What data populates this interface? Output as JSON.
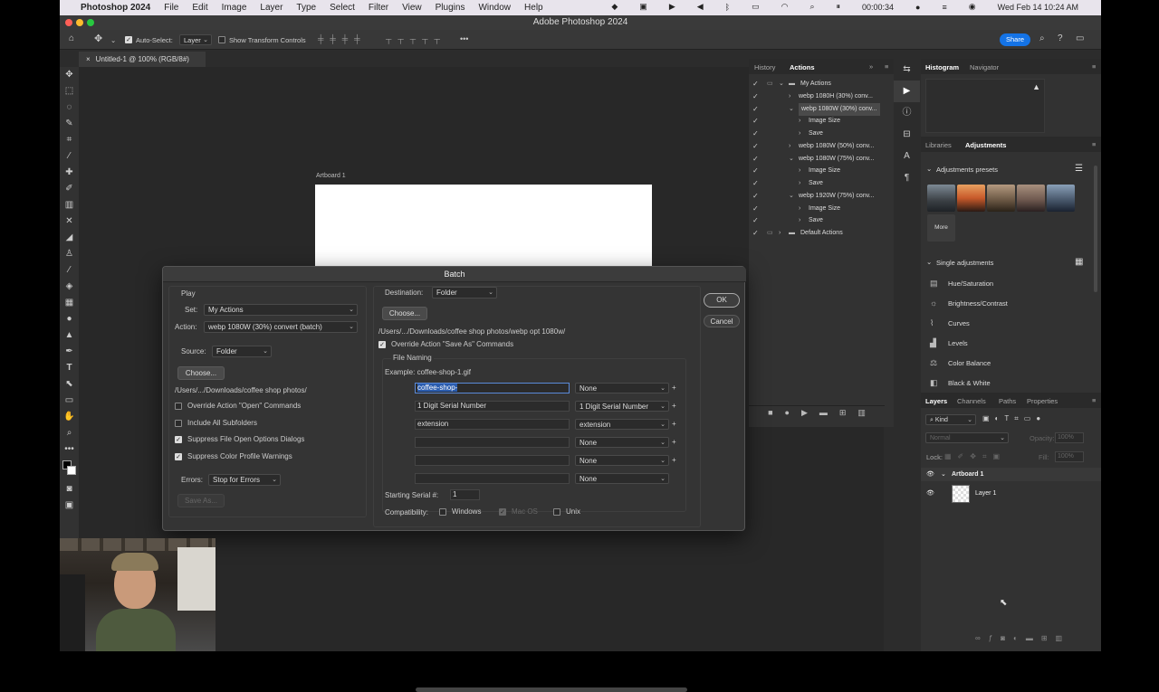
{
  "menubar": {
    "apple": "",
    "app": "Photoshop 2024",
    "items": [
      "File",
      "Edit",
      "Image",
      "Layer",
      "Type",
      "Select",
      "Filter",
      "View",
      "Plugins",
      "Window",
      "Help"
    ],
    "recording_time": "00:00:34",
    "datetime": "Wed Feb 14  10:24 AM"
  },
  "window": {
    "title": "Adobe Photoshop 2024",
    "share": "Share"
  },
  "options": {
    "auto_select": "Auto-Select:",
    "auto_select_value": "Layer",
    "transform_controls": "Show Transform Controls",
    "more": "•••"
  },
  "document": {
    "tab": "Untitled-1 @ 100% (RGB/8#)",
    "artboard_label": "Artboard 1"
  },
  "actions_panel": {
    "tabs": [
      "History",
      "Actions"
    ],
    "rows": [
      {
        "label": "My Actions",
        "indent": 0,
        "folder": true,
        "open": true
      },
      {
        "label": "webp 1080H (30%) conv...",
        "indent": 1
      },
      {
        "label": "webp 1080W (30%) conv...",
        "indent": 1,
        "open": true,
        "selected": true
      },
      {
        "label": "Image Size",
        "indent": 2
      },
      {
        "label": "Save",
        "indent": 2
      },
      {
        "label": "webp 1080W (50%) conv...",
        "indent": 1
      },
      {
        "label": "webp 1080W (75%) conv...",
        "indent": 1,
        "open": true
      },
      {
        "label": "Image Size",
        "indent": 2
      },
      {
        "label": "Save",
        "indent": 2
      },
      {
        "label": "webp 1920W (75%) conv...",
        "indent": 1,
        "open": true
      },
      {
        "label": "Image Size",
        "indent": 2
      },
      {
        "label": "Save",
        "indent": 2
      },
      {
        "label": "Default Actions",
        "indent": 0,
        "folder": true
      }
    ]
  },
  "right_panels": {
    "histogram_tabs": [
      "Histogram",
      "Navigator"
    ],
    "adjust_tabs": [
      "Libraries",
      "Adjustments"
    ],
    "presets_title": "Adjustments presets",
    "more": "More",
    "single_title": "Single adjustments",
    "adjustments": [
      "Hue/Saturation",
      "Brightness/Contrast",
      "Curves",
      "Levels",
      "Color Balance",
      "Black & White"
    ],
    "layers_tabs": [
      "Layers",
      "Channels",
      "Paths",
      "Properties"
    ],
    "kind": "Kind",
    "blend": "Normal",
    "opacity": "Opacity:",
    "opacity_val": "100%",
    "lock": "Lock:",
    "fill": "Fill:",
    "fill_val": "100%",
    "layers": [
      "Artboard 1",
      "Layer 1"
    ]
  },
  "batch": {
    "title": "Batch",
    "play": "Play",
    "set_label": "Set:",
    "set_value": "My Actions",
    "action_label": "Action:",
    "action_value": "webp 1080W (30%) convert (batch)",
    "source_label": "Source:",
    "source_value": "Folder",
    "choose": "Choose...",
    "source_path": "/Users/.../Downloads/coffee shop photos/",
    "override_open": "Override Action \"Open\" Commands",
    "include_sub": "Include All Subfolders",
    "suppress_file": "Suppress File Open Options Dialogs",
    "suppress_color": "Suppress Color Profile Warnings",
    "errors_label": "Errors:",
    "errors_value": "Stop for Errors",
    "save_as": "Save As...",
    "dest_label": "Destination:",
    "dest_value": "Folder",
    "dest_choose": "Choose...",
    "dest_path": "/Users/.../Downloads/coffee shop photos/webp opt 1080w/",
    "override_save": "Override Action \"Save As\" Commands",
    "file_naming": "File Naming",
    "example": "Example: coffee-shop-1.gif",
    "naming": [
      {
        "field": "coffee-shop-",
        "select": "None"
      },
      {
        "field": "1 Digit Serial Number",
        "select": "1 Digit Serial Number"
      },
      {
        "field": "extension",
        "select": "extension"
      },
      {
        "field": "",
        "select": "None"
      },
      {
        "field": "",
        "select": "None"
      },
      {
        "field": "",
        "select": "None"
      }
    ],
    "serial_label": "Starting Serial #:",
    "serial_value": "1",
    "compat_label": "Compatibility:",
    "windows": "Windows",
    "macos": "Mac OS",
    "unix": "Unix",
    "ok": "OK",
    "cancel": "Cancel"
  }
}
